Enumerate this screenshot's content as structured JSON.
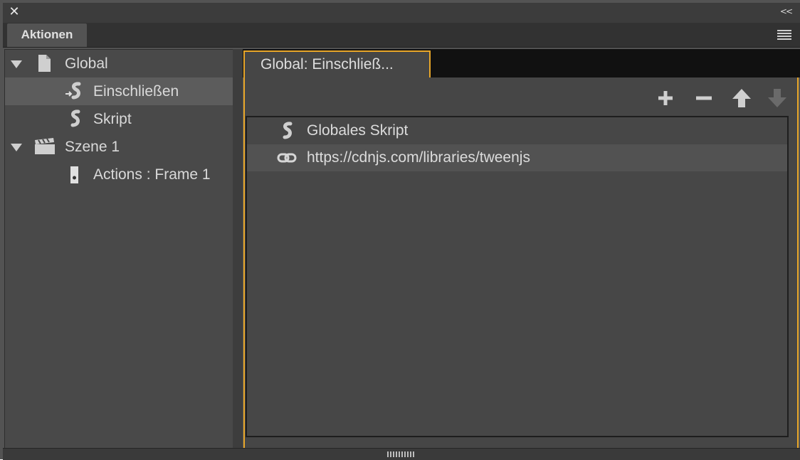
{
  "window": {
    "close_icon": "close-icon",
    "collapse_label": "<<",
    "tab_label": "Aktionen",
    "menu_icon": "panel-menu-icon"
  },
  "tree": {
    "items": [
      {
        "label": "Global",
        "icon": "document-icon",
        "expanded": true,
        "level": 0
      },
      {
        "label": "Einschließen",
        "icon": "include-script-icon",
        "selected": true,
        "level": 1
      },
      {
        "label": "Skript",
        "icon": "script-icon",
        "level": 1
      },
      {
        "label": "Szene 1",
        "icon": "clapperboard-icon",
        "expanded": true,
        "level": 0
      },
      {
        "label": "Actions : Frame 1",
        "icon": "frame-icon",
        "level": 1
      }
    ]
  },
  "editor": {
    "tab_label": "Global: Einschließ...",
    "toolbar": {
      "add_icon": "plus-icon",
      "remove_icon": "minus-icon",
      "up_icon": "arrow-up-icon",
      "down_icon": "arrow-down-icon"
    },
    "list": [
      {
        "label": "Globales Skript",
        "icon": "script-icon"
      },
      {
        "label": "https://cdnjs.com/libraries/tweenjs",
        "icon": "link-icon"
      }
    ]
  },
  "colors": {
    "accent": "#e8a628",
    "panel": "#535353",
    "selected_row": "#5c5c5c"
  }
}
